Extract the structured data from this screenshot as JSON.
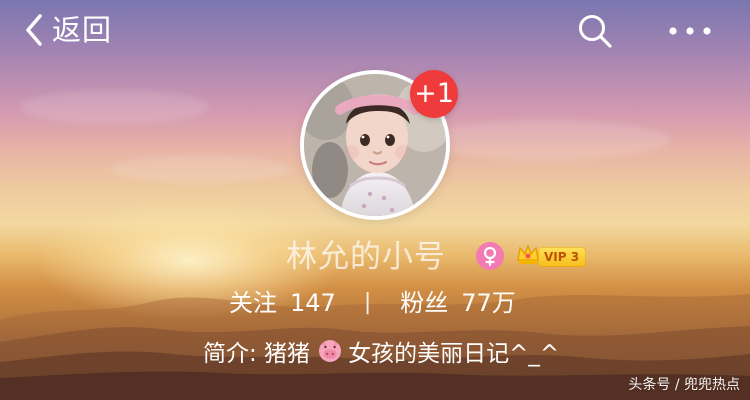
{
  "header": {
    "back_label": "返回",
    "back_icon": "chevron-left-icon",
    "search_icon": "search-icon",
    "more_icon": "more-icon"
  },
  "profile": {
    "avatar_alt": "avatar",
    "notification_badge": "+1",
    "username": "林允的小号",
    "gender_badge_icon": "female-icon",
    "vip_level": "VIP 3",
    "crown_icon": "crown-icon"
  },
  "stats": {
    "following_label": "关注",
    "following_value": "147",
    "divider": "|",
    "followers_label": "粉丝",
    "followers_value": "77万"
  },
  "bio": {
    "prefix": "简介: 猪猪",
    "emoji_icon": "pig-face-icon",
    "suffix": "女孩的美丽日记^_^"
  },
  "watermark": {
    "text": "头条号 / 兜兜热点"
  },
  "colors": {
    "notification_red": "#ef3b3b",
    "vip_gold": "#f6bd1a",
    "gender_pink": "#f47ab3"
  }
}
